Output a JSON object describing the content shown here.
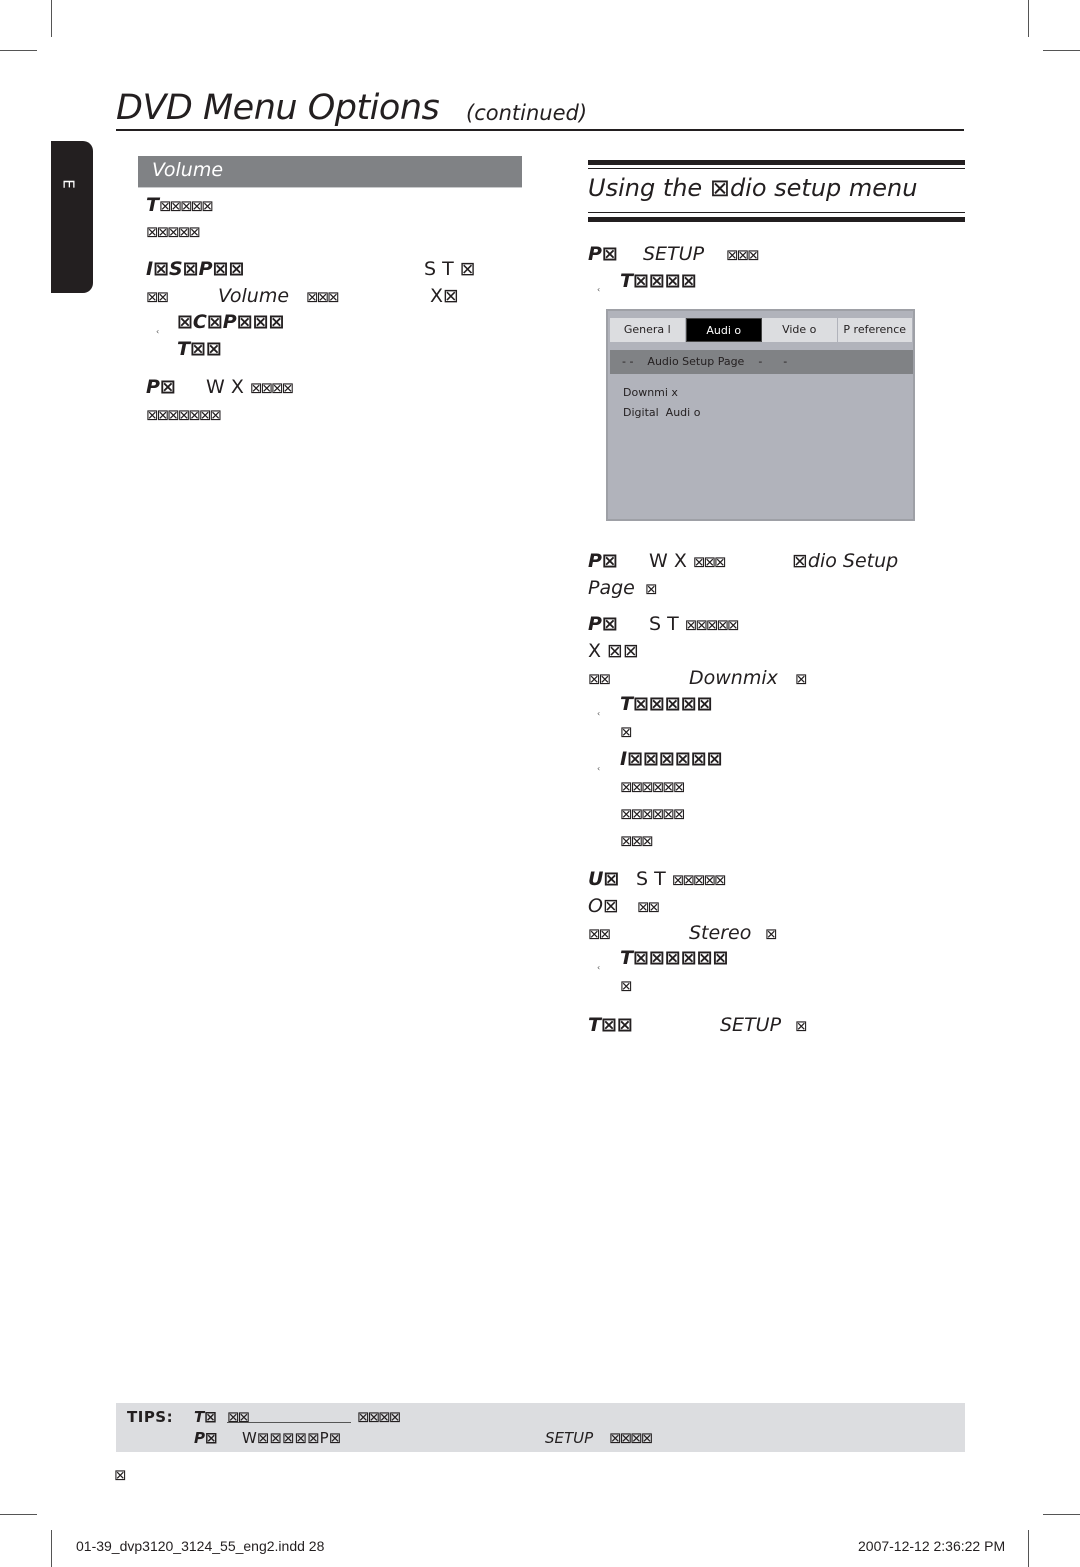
{
  "header": {
    "title": "DVD Menu Options",
    "continued": "(continued)",
    "language_tab": "E"
  },
  "left_column": {
    "section_bar": "Volume",
    "para1": {
      "line1_lead": "T",
      "line1_rest": "⊠⊠⊠⊠⊠",
      "line2": "⊠⊠⊠⊠⊠"
    },
    "para2": {
      "line1_lead": "I⊠S⊠P⊠⊠",
      "line1_keys": "S  T ⊠",
      "line2_a": "⊠⊠",
      "line2_option": "Volume",
      "line2_b": "⊠⊠⊠",
      "line2_key": "X⊠",
      "bullet_line1": "⊠C⊠P⊠⊠⊠",
      "bullet_line2": "T⊠⊠"
    },
    "para3": {
      "line1_lead": "P⊠",
      "line1_keys": "W X",
      "line1_rest": "⊠⊠⊠⊠",
      "line2": "⊠⊠⊠⊠⊠⊠⊠"
    }
  },
  "right_column": {
    "heading": "Using the ⊠dio setup menu",
    "step1": {
      "lead": "P⊠",
      "key": "SETUP",
      "rest": "⊠⊠⊠",
      "bullet": "T⊠⊠⊠⊠"
    },
    "setup_menu": {
      "tabs": [
        {
          "label": "Genera l",
          "active": false
        },
        {
          "label": "Audi o",
          "active": true
        },
        {
          "label": "Vide o",
          "active": false
        },
        {
          "label": "P reference",
          "active": false
        }
      ],
      "page_header": "- -    Audio Setup Page    -      -",
      "items": [
        "Downmi x",
        "Digital  Audi o"
      ]
    },
    "step2": {
      "lead": "P⊠",
      "keys": "W X",
      "rest": "⊠⊠⊠",
      "target": "⊠dio Setup",
      "line2_target": "Page",
      "line2_end": "⊠"
    },
    "step3": {
      "lead": "P⊠",
      "keys": "S  T",
      "rest": "⊠⊠⊠⊠⊠",
      "line2": " X ⊠⊠",
      "line3_a": "⊠⊠",
      "line3_option": "Downmix",
      "line3_end": "⊠",
      "bullet1_line1": "T⊠⊠⊠⊠⊠",
      "bullet1_line2": "⊠",
      "bullet2_line1": "I⊠⊠⊠⊠⊠⊠",
      "bullet2_line2": "⊠⊠⊠⊠⊠⊠",
      "bullet2_line3": "⊠⊠⊠⊠⊠⊠",
      "bullet2_line4": "⊠⊠⊠"
    },
    "step4": {
      "lead": "U⊠",
      "keys": "S  T",
      "rest": "⊠⊠⊠⊠⊠",
      "line2_lead": "O⊠",
      "line2_rest": "⊠⊠",
      "line3_a": "⊠⊠",
      "line3_option": "Stereo",
      "line3_end": "⊠",
      "bullet_line1": "T⊠⊠⊠⊠⊠⊠",
      "bullet_line2": "⊠"
    },
    "step5": {
      "lead": "T⊠⊠",
      "key": "SETUP",
      "end": "⊠"
    }
  },
  "tips": {
    "label": "TIPS:",
    "line1_lead": "T⊠",
    "line1_b": "⊠⊠",
    "line1_c": "⊠⊠⊠⊠",
    "line2_lead": "P⊠",
    "line2_b": "W⊠⊠⊠⊠⊠P⊠",
    "line2_key": "SETUP",
    "line2_c": "⊠⊠⊠⊠"
  },
  "page_number": "⊠",
  "footer": {
    "file": "01-39_dvp3120_3124_55_eng2.indd   28",
    "timestamp": "2007-12-12   2:36:22 PM"
  }
}
